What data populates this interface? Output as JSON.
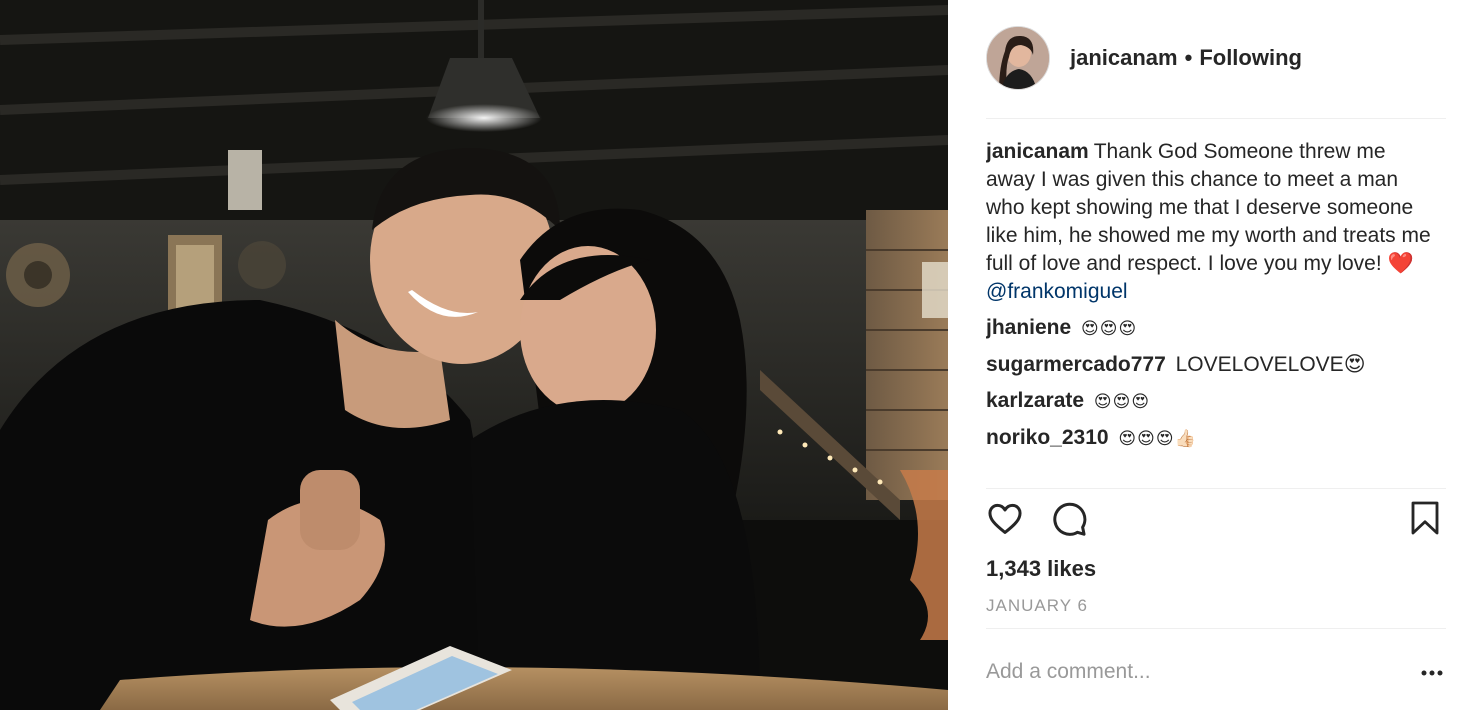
{
  "post": {
    "photo_alt": "Couple smiling at a restaurant table",
    "username": "janicanam",
    "follow_label": "Following",
    "separator": "•",
    "caption": "Thank God Someone threw me away I was given this chance to meet a man who kept showing me that I deserve someone like him, he showed me my worth and treats me full of love and respect. I love you my love! ❤️",
    "caption_mention": "@frankomiguel"
  },
  "comments": [
    {
      "user": "jhaniene",
      "text": "😍😍😍"
    },
    {
      "user": "sugarmercado777",
      "text": "LOVELOVELOVE😍"
    },
    {
      "user": "karlzarate",
      "text": "😍😍😍"
    },
    {
      "user": "noriko_2310",
      "text": "😍😍😍👍🏻"
    }
  ],
  "stats": {
    "likes": "1,343 likes",
    "date": "JANUARY 6"
  },
  "composer": {
    "placeholder": "Add a comment..."
  },
  "icons": {
    "like": "heart-outline-icon",
    "comment": "speech-bubble-icon",
    "save": "bookmark-outline-icon",
    "more": "ellipsis-icon"
  }
}
